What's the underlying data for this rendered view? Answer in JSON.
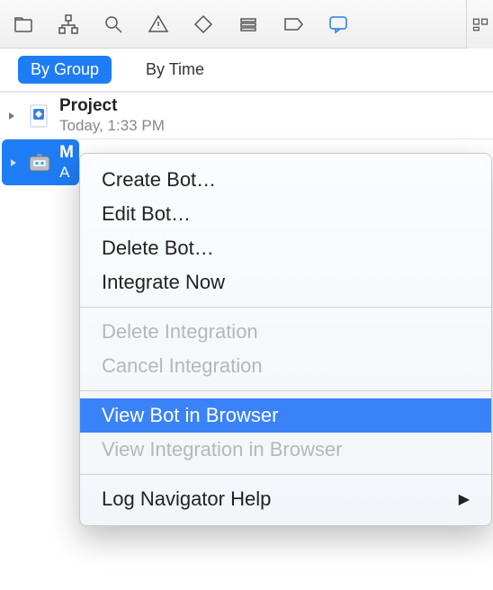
{
  "filterBar": {
    "byGroup": "By Group",
    "byTime": "By Time"
  },
  "rows": {
    "project": {
      "title": "Project",
      "subtitle": "Today, 1:33 PM"
    },
    "bot": {
      "title": "M",
      "subtitle": "A"
    }
  },
  "menu": {
    "createBot": "Create Bot…",
    "editBot": "Edit Bot…",
    "deleteBot": "Delete Bot…",
    "integrateNow": "Integrate Now",
    "deleteIntegration": "Delete Integration",
    "cancelIntegration": "Cancel Integration",
    "viewBot": "View Bot in Browser",
    "viewIntegration": "View Integration in Browser",
    "help": "Log Navigator Help"
  }
}
